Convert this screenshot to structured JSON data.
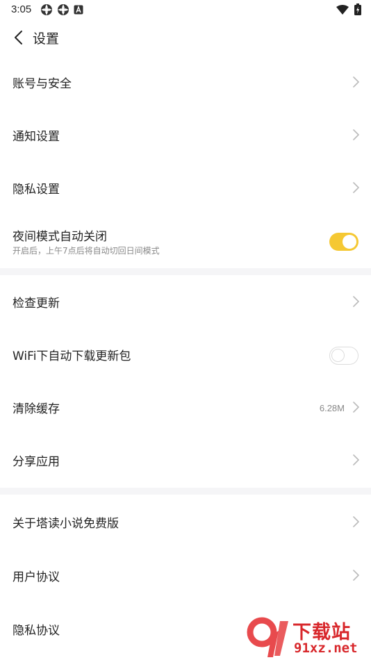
{
  "status_bar": {
    "time": "3:05",
    "left_icons": [
      "notification-icon",
      "notification-icon",
      "text-a-icon"
    ],
    "right_icons": [
      "wifi-icon",
      "battery-icon"
    ]
  },
  "header": {
    "back_icon": "chevron-left-icon",
    "title": "设置"
  },
  "settings": {
    "account_security": "账号与安全",
    "notification_settings": "通知设置",
    "privacy_settings": "隐私设置",
    "night_mode": {
      "label": "夜间模式自动关闭",
      "subtitle": "开启后，上午7点后将自动切回日间模式",
      "enabled": true
    },
    "check_update": "检查更新",
    "wifi_auto_download": {
      "label": "WiFi下自动下载更新包",
      "enabled": false
    },
    "clear_cache": {
      "label": "清除缓存",
      "value": "6.28M"
    },
    "share_app": "分享应用",
    "about": "关于塔读小说免费版",
    "user_agreement": "用户协议",
    "privacy_agreement": "隐私协议"
  },
  "watermark": {
    "title": "下载站",
    "url": "91xz.net"
  },
  "colors": {
    "accent": "#f5c833",
    "divider": "#f5f5f7",
    "watermark": "#d8272b"
  }
}
